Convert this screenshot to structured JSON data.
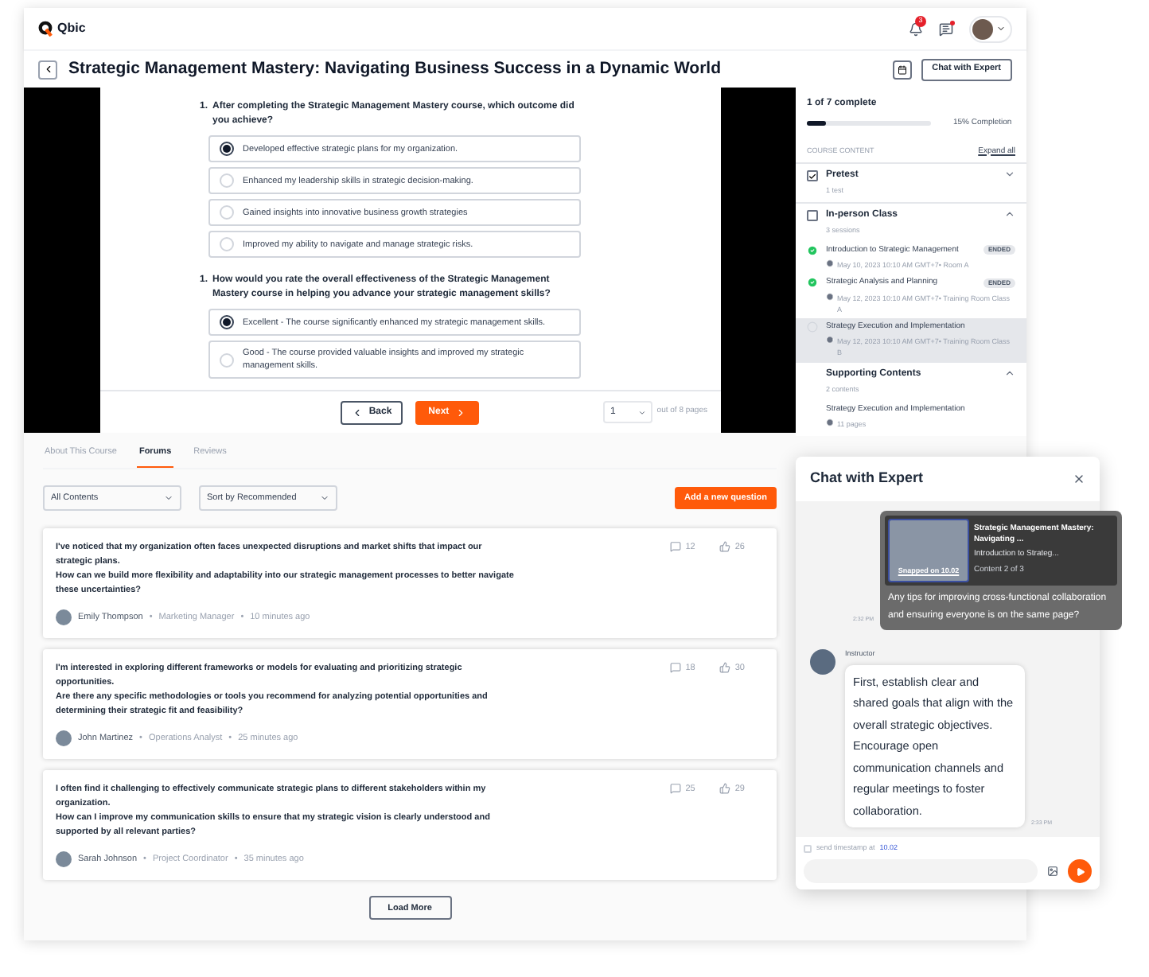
{
  "app": {
    "logo": "Qbic",
    "notification_count": "3",
    "messages_unread": true
  },
  "course": {
    "title": "Strategic Management Mastery: Navigating Business Success in a Dynamic World",
    "chat_button": "Chat with Expert"
  },
  "quiz": {
    "questions": [
      {
        "number": "1.",
        "text": "After completing the Strategic Management Mastery course, which outcome did you achieve?",
        "options": [
          {
            "label": "Developed effective strategic plans for my organization.",
            "selected": true
          },
          {
            "label": "Enhanced my leadership skills in strategic decision-making.",
            "selected": false
          },
          {
            "label": "Gained insights into innovative business growth strategies",
            "selected": false
          },
          {
            "label": "Improved my ability to navigate and manage strategic risks.",
            "selected": false
          }
        ]
      },
      {
        "number": "1.",
        "text": "How would you rate the overall effectiveness of the Strategic Management Mastery course in helping you advance your strategic management skills?",
        "options": [
          {
            "label": "Excellent - The course significantly enhanced my strategic management skills.",
            "selected": true
          },
          {
            "label": "Good - The course provided valuable insights and improved my strategic management skills.",
            "selected": false
          }
        ]
      }
    ],
    "back": "Back",
    "next": "Next",
    "page": "1",
    "page_suffix": "out of 8 pages"
  },
  "progress": {
    "summary": "1 of 7 complete",
    "level": 0.15,
    "completion": "15% Completion"
  },
  "course_content": {
    "heading": "COURSE CONTENT",
    "expand_all": "Expand all",
    "sections": [
      {
        "kind": "checkbox",
        "title": "Pretest",
        "subtitle": "1 test",
        "checked": true,
        "expanded": false
      },
      {
        "kind": "checkbox",
        "title": "In-person Class",
        "subtitle": "3 sessions",
        "checked": false,
        "expanded": true,
        "items": [
          {
            "kind": "session",
            "title": "Introduction to Strategic Management",
            "badge": "ENDED",
            "meta": "May 10, 2023 10:10 AM GMT+7• Room A",
            "done": true,
            "selected": false
          },
          {
            "kind": "session",
            "title": "Strategic Analysis and Planning",
            "badge": "ENDED",
            "meta": "May 12, 2023 10:10 AM GMT+7• Training Room Class A",
            "done": true,
            "selected": false
          },
          {
            "kind": "session",
            "title": "Strategy Execution and Implementation",
            "meta": "May 12, 2023 10:10 AM GMT+7• Training Room Class B",
            "done": false,
            "selected": true
          }
        ]
      },
      {
        "kind": "plain",
        "title": "Supporting Contents",
        "subtitle": "2 contents",
        "expanded": true,
        "items": [
          {
            "kind": "document",
            "title": "Strategy Execution and Implementation",
            "meta": "11 pages",
            "selected": false
          }
        ]
      }
    ]
  },
  "tabs": [
    {
      "label": "About This Course",
      "selected": false
    },
    {
      "label": "Forums",
      "selected": true
    },
    {
      "label": "Reviews",
      "selected": false
    }
  ],
  "filters": [
    "All Contents",
    "Sort by Recommended"
  ],
  "add_question": "Add a new question",
  "posts": [
    {
      "paragraphs": [
        "I've noticed that my organization often faces unexpected disruptions and market shifts that impact our strategic plans.",
        "How can we build more flexibility and adaptability into our strategic management processes to better navigate these uncertainties?"
      ],
      "comments": "12",
      "likes": "26",
      "author": "Emily Thompson",
      "role": "Marketing Manager",
      "time": "10 minutes ago"
    },
    {
      "paragraphs": [
        "I'm interested in exploring different frameworks or models for evaluating and prioritizing strategic opportunities.",
        "Are there any specific methodologies or tools you recommend for analyzing potential opportunities and determining their strategic fit and feasibility?"
      ],
      "comments": "18",
      "likes": "30",
      "author": "John Martinez",
      "role": "Operations Analyst",
      "time": "25 minutes ago"
    },
    {
      "paragraphs": [
        "I often find it challenging to effectively communicate strategic plans to different stakeholders within my organization.",
        "How can I improve my communication skills to ensure that my strategic vision is clearly understood and supported by all relevant parties?"
      ],
      "comments": "25",
      "likes": "29",
      "author": "Sarah Johnson",
      "role": "Project Coordinator",
      "time": "35 minutes ago"
    }
  ],
  "meta_separator": "•",
  "load_more": "Load More",
  "chat": {
    "title": "Chat with Expert",
    "messages": [
      {
        "kind": "outgoing",
        "snapshot": {
          "title": "Strategic Management Mastery: Navigating ...",
          "subtitle": "Introduction to Strateg...",
          "progress": "Content 2 of 3",
          "stamp": "Snapped on 10.02"
        },
        "text": "Any tips for improving cross-functional collaboration and ensuring everyone is on the same page?",
        "time": "2:32 PM"
      },
      {
        "kind": "incoming",
        "sender": "Instructor",
        "text": "First, establish clear and shared goals that align with the overall strategic objectives. Encourage open communication channels and regular meetings to foster collaboration.",
        "time": "2:33 PM"
      }
    ],
    "timestamp_label": "send timestamp at",
    "timestamp": "10.02",
    "timestamp_checked": false
  }
}
